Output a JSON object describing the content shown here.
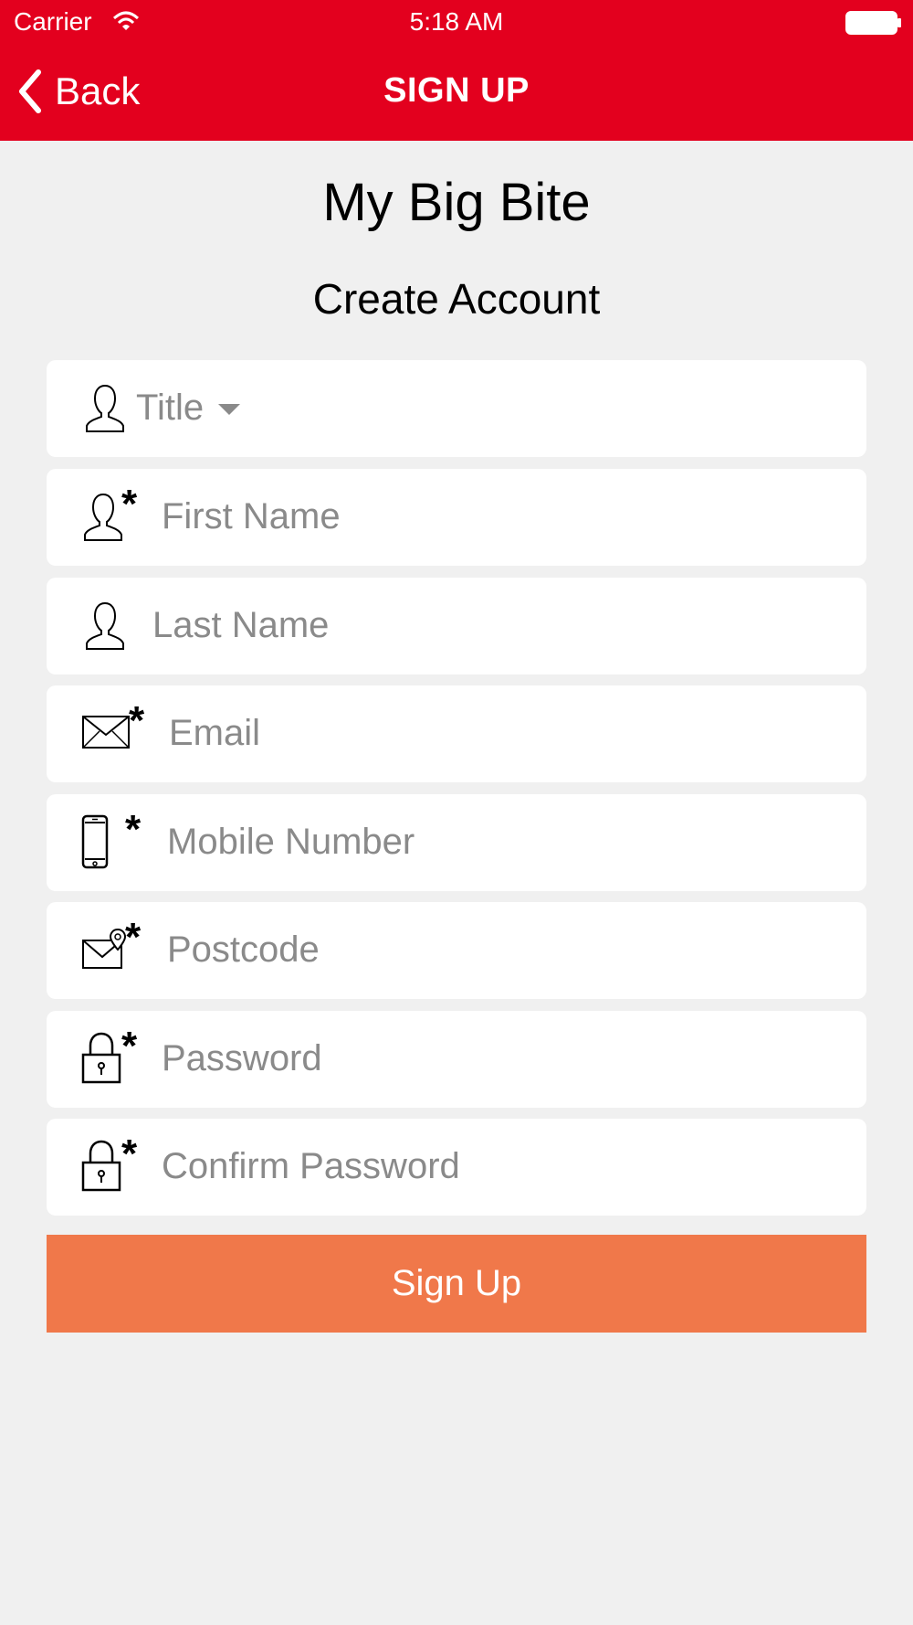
{
  "status_bar": {
    "carrier": "Carrier",
    "time": "5:18 AM"
  },
  "nav": {
    "back_label": "Back",
    "title": "SIGN UP"
  },
  "app_name": "My Big Bite",
  "subtitle": "Create Account",
  "form": {
    "title": {
      "placeholder": "Title",
      "icon": "user-icon"
    },
    "first_name": {
      "placeholder": "First Name",
      "required": "*",
      "icon": "user-icon"
    },
    "last_name": {
      "placeholder": "Last Name",
      "icon": "user-icon"
    },
    "email": {
      "placeholder": "Email",
      "required": "*",
      "icon": "envelope-icon"
    },
    "mobile": {
      "placeholder": "Mobile Number",
      "required": "*",
      "icon": "mobile-phone-icon"
    },
    "postcode": {
      "placeholder": "Postcode",
      "required": "*",
      "icon": "mail-location-icon"
    },
    "password": {
      "placeholder": "Password",
      "required": "*",
      "icon": "lock-icon"
    },
    "confirm_password": {
      "placeholder": "Confirm Password",
      "required": "*",
      "icon": "lock-icon"
    }
  },
  "signup_button": "Sign Up",
  "colors": {
    "header": "#e3001e",
    "button": "#f0784a",
    "background": "#f0f0f0"
  }
}
